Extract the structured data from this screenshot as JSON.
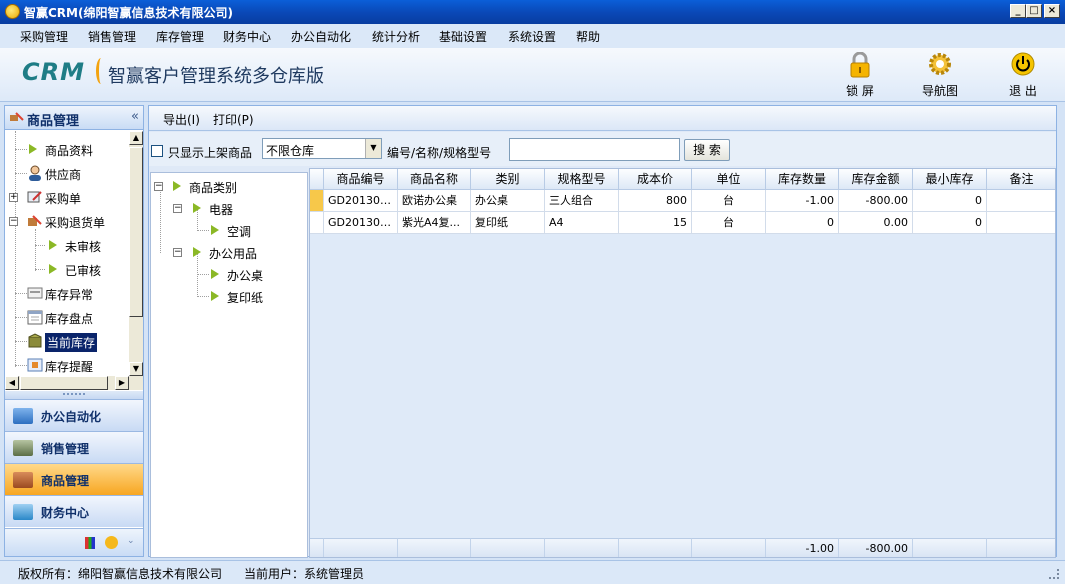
{
  "window": {
    "title": "智赢CRM(绵阳智赢信息技术有限公司)",
    "min": "_",
    "max": "□",
    "close": "×"
  },
  "menu": [
    "采购管理",
    "销售管理",
    "库存管理",
    "财务中心",
    "办公自动化",
    "统计分析",
    "基础设置",
    "系统设置",
    "帮助"
  ],
  "banner": {
    "logo": "CRM",
    "product": "智赢客户管理系统多仓库版",
    "lock": "锁 屏",
    "navmap": "导航图",
    "exit": "退 出"
  },
  "nav": {
    "title": "商品管理",
    "collapse": "«",
    "items": [
      "商品资料",
      "供应商",
      "采购单",
      "采购退货单",
      "未审核",
      "已审核",
      "库存异常",
      "库存盘点",
      "当前库存",
      "库存提醒"
    ],
    "groups": [
      "办公自动化",
      "销售管理",
      "商品管理",
      "财务中心"
    ]
  },
  "toolbar": {
    "export": "导出(I)",
    "print": "打印(P)"
  },
  "filter": {
    "only_listed": "只显示上架商品",
    "warehouse": "不限仓库",
    "search_label": "编号/名称/规格型号",
    "search_value": "",
    "search_btn": "搜 索"
  },
  "category_tree": [
    "商品类别",
    "电器",
    "空调",
    "办公用品",
    "办公桌",
    "复印纸"
  ],
  "grid": {
    "columns": [
      "商品编号",
      "商品名称",
      "类别",
      "规格型号",
      "成本价",
      "单位",
      "库存数量",
      "库存金额",
      "最小库存",
      "备注"
    ],
    "rows": [
      [
        "GD201309...",
        "欧诺办公桌",
        "办公桌",
        "三人组合",
        "800",
        "台",
        "-1.00",
        "-800.00",
        "0",
        ""
      ],
      [
        "GD201309...",
        "紫光A4复...",
        "复印纸",
        "A4",
        "15",
        "台",
        "0",
        "0.00",
        "0",
        ""
      ]
    ],
    "footer": {
      "qty_total": "-1.00",
      "amount_total": "-800.00"
    }
  },
  "status": {
    "copyright": "版权所有：绵阳智赢信息技术有限公司",
    "user": "当前用户：系统管理员"
  }
}
